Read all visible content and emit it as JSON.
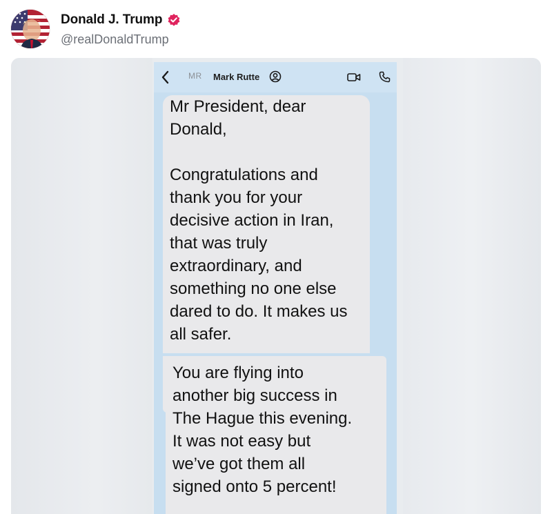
{
  "post": {
    "display_name": "Donald J. Trump",
    "handle": "@realDonaldTrump",
    "verified_color": "#e0245e"
  },
  "screenshot": {
    "header": {
      "contact_initials": "MR",
      "contact_name": "Mark Rutte",
      "back_icon": "chevron-left-icon",
      "contact_icon": "person-circle-icon",
      "video_icon": "video-camera-icon",
      "call_icon": "phone-icon"
    },
    "message_1": {
      "lines_a": [
        "Mr President, dear",
        "Donald,"
      ],
      "lines_b": [
        "Congratulations and",
        "thank you for your",
        "decisive action in Iran,",
        "that was truly",
        "extraordinary, and",
        "something no one else",
        "dared to do.  It makes us",
        "all safer."
      ]
    },
    "message_2": {
      "lines": [
        "You are flying into",
        "another big success in",
        "The Hague this evening.",
        "It was not easy but",
        "we’ve got them all",
        "signed onto 5 percent!"
      ]
    },
    "colors": {
      "chat_background": "#c7def0",
      "bubble": "#e9e9eb"
    }
  }
}
